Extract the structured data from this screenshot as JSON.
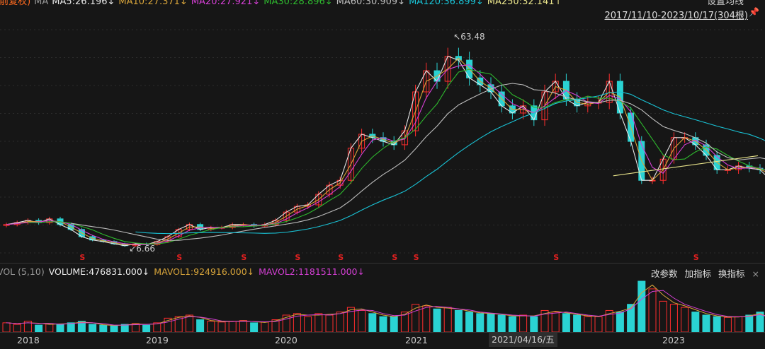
{
  "header": {
    "adjust_label": "(前复权)",
    "ma_prefix": "MA",
    "ma": [
      {
        "label": "MA5:26.196↓",
        "color": "#e6e6e6"
      },
      {
        "label": "MA10:27.371↓",
        "color": "#d7a43a"
      },
      {
        "label": "MA20:27.921↓",
        "color": "#d43fd4"
      },
      {
        "label": "MA30:28.896↓",
        "color": "#2eb82e"
      },
      {
        "label": "MA60:30.909↓",
        "color": "#bdbdbd"
      },
      {
        "label": "MA120:36.899↓",
        "color": "#19c3d6"
      },
      {
        "label": "MA250:32.141↑",
        "color": "#e8e38a"
      }
    ],
    "set_ma": "设置均线",
    "range": "2017/11/10-2023/10/17(304根)"
  },
  "volume_panel": {
    "name": "VOL (5,10)",
    "volume": "VOLUME:476831.000↓",
    "mavol1": "MAVOL1:924916.000↓",
    "mavol2": "MAVOL2:1181511.000↓",
    "actions": [
      "改参数",
      "加指标",
      "换指标"
    ],
    "close": "×"
  },
  "colors": {
    "up": "#ff2d2d",
    "down": "#2ad3d3",
    "background": "#161616"
  },
  "chart_data": {
    "type": "candlestick",
    "period": "monthly approximation of weekly bars",
    "x": [
      "2017-11",
      "2017-12",
      "2018-01",
      "2018-02",
      "2018-03",
      "2018-04",
      "2018-05",
      "2018-06",
      "2018-07",
      "2018-08",
      "2018-09",
      "2018-10",
      "2018-11",
      "2018-12",
      "2019-01",
      "2019-02",
      "2019-03",
      "2019-04",
      "2019-05",
      "2019-06",
      "2019-07",
      "2019-08",
      "2019-09",
      "2019-10",
      "2019-11",
      "2019-12",
      "2020-01",
      "2020-02",
      "2020-03",
      "2020-04",
      "2020-05",
      "2020-06",
      "2020-07",
      "2020-08",
      "2020-09",
      "2020-10",
      "2020-11",
      "2020-12",
      "2021-01",
      "2021-02",
      "2021-03",
      "2021-04",
      "2021-05",
      "2021-06",
      "2021-07",
      "2021-08",
      "2021-09",
      "2021-10",
      "2021-11",
      "2021-12",
      "2022-01",
      "2022-02",
      "2022-03",
      "2022-04",
      "2022-05",
      "2022-06",
      "2022-07",
      "2022-08",
      "2022-09",
      "2022-10",
      "2022-11",
      "2022-12",
      "2023-01",
      "2023-02",
      "2023-03",
      "2023-04",
      "2023-05",
      "2023-06",
      "2023-07",
      "2023-08",
      "2023-09",
      "2023-10"
    ],
    "close": [
      12.3,
      12.8,
      13.4,
      12.8,
      13.8,
      12.3,
      11,
      9.1,
      8.2,
      7.8,
      7.2,
      6.7,
      7.2,
      7,
      7.8,
      9.1,
      11,
      12.3,
      11,
      11.5,
      11.5,
      12.3,
      12.3,
      11.9,
      12.3,
      13.4,
      15.6,
      17.1,
      17.5,
      20.3,
      22.7,
      24,
      32.5,
      36.2,
      35.3,
      34.3,
      33.4,
      37.1,
      47.4,
      53,
      50.2,
      56.8,
      55.8,
      51.1,
      49.3,
      47.4,
      43.7,
      41.8,
      43.7,
      40,
      47.4,
      50.2,
      45.5,
      43.7,
      44.6,
      44.6,
      50.2,
      41.8,
      34.3,
      24,
      24,
      29.6,
      35.3,
      35.3,
      33.4,
      30.6,
      26.8,
      26.8,
      27.8,
      27.2,
      26.8,
      24
    ],
    "volume": [
      600000,
      500000,
      700000,
      450000,
      550000,
      500000,
      600000,
      700000,
      500000,
      450000,
      400000,
      500000,
      550000,
      450000,
      600000,
      900000,
      1000000,
      1100000,
      800000,
      700000,
      650000,
      700000,
      750000,
      600000,
      650000,
      800000,
      1100000,
      1200000,
      1000000,
      1200000,
      1100000,
      1300000,
      1600000,
      1400000,
      1200000,
      1000000,
      1000000,
      1300000,
      1800000,
      1700000,
      1500000,
      1600000,
      1400000,
      1300000,
      1200000,
      1200000,
      1100000,
      1000000,
      1100000,
      1000000,
      1400000,
      1300000,
      1200000,
      1100000,
      1000000,
      1000000,
      1400000,
      1300000,
      1800000,
      3300000,
      2800000,
      2000000,
      1800000,
      1600000,
      1300000,
      1100000,
      1000000,
      950000,
      1000000,
      1100000,
      1300000,
      476831
    ],
    "annotations": [
      {
        "text": "63.48",
        "date": "2021-04",
        "value": 63.48,
        "kind": "high"
      },
      {
        "text": "6.66",
        "date": "2018-10",
        "value": 6.66,
        "kind": "low"
      }
    ],
    "signal_marker": "S",
    "signal_dates": [
      "2018-06",
      "2019-03",
      "2019-09",
      "2020-02",
      "2020-06",
      "2020-11",
      "2021-01",
      "2022-02",
      "2023-03"
    ],
    "x_ticks": [
      "2018",
      "2019",
      "2020",
      "2021",
      "2023"
    ],
    "cursor_label": "2021/04/16/五",
    "ylim": [
      6.66,
      63.48
    ],
    "grid": "horizontal dotted"
  }
}
